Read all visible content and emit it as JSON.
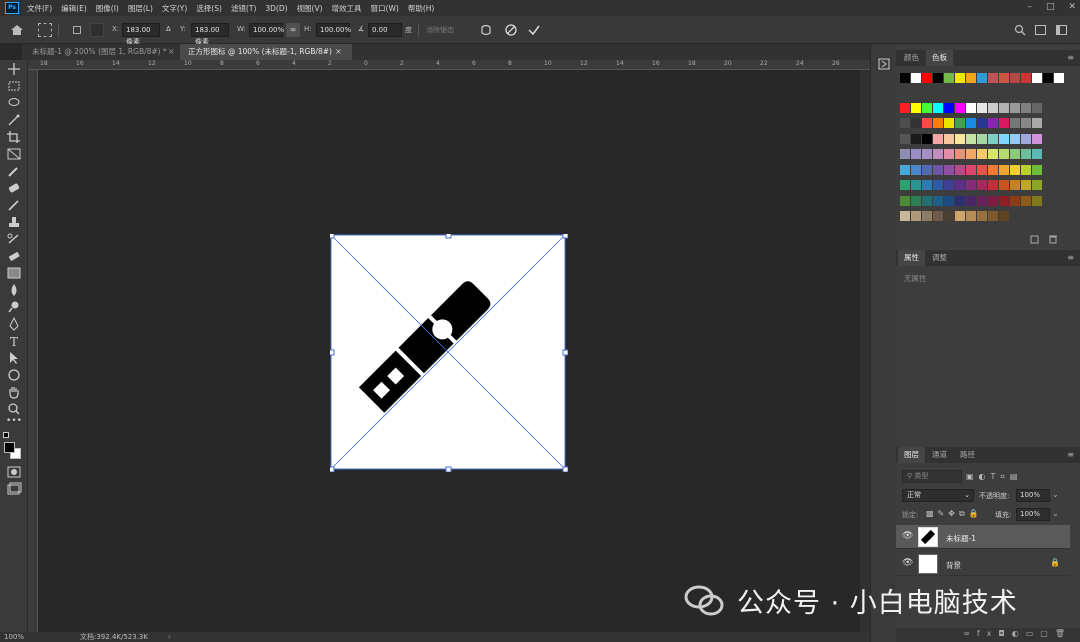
{
  "app": {
    "logo": "Ps"
  },
  "menu": [
    "文件(F)",
    "编辑(E)",
    "图像(I)",
    "图层(L)",
    "文字(Y)",
    "选择(S)",
    "滤镜(T)",
    "3D(D)",
    "视图(V)",
    "增效工具",
    "窗口(W)",
    "帮助(H)"
  ],
  "options": {
    "x_label": "X:",
    "x_value": "183.00 像素",
    "y_label": "Y:",
    "y_value": "183.00 像素",
    "w_label": "W:",
    "w_value": "100.00%",
    "h_label": "H:",
    "h_value": "100.00%",
    "angle_value": "0.00",
    "angle_unit": "度",
    "interp_label": "消除锯齿"
  },
  "tabs": [
    {
      "label": "未标题-1 @ 200% (图层 1, RGB/8#) *",
      "active": false
    },
    {
      "label": "正方形图标 @ 100% (未标题-1, RGB/8#)",
      "active": true
    }
  ],
  "ruler": {
    "h_ticks": [
      "18",
      "16",
      "14",
      "12",
      "10",
      "8",
      "6",
      "4",
      "2",
      "0",
      "2",
      "4",
      "6",
      "8",
      "10",
      "12",
      "14",
      "16",
      "18",
      "20",
      "22",
      "24",
      "26"
    ]
  },
  "status": {
    "zoom": "100%",
    "doc": "文档:392.4K/523.3K"
  },
  "swatches_panel": {
    "tab1": "颜色",
    "tab2": "色板"
  },
  "props_panel": {
    "tab1": "属性",
    "tab2": "调整",
    "empty": "无属性"
  },
  "layers_panel": {
    "tab1": "图层",
    "tab2": "通道",
    "tab3": "路径",
    "filter_placeholder": "类型",
    "blend_mode": "正常",
    "opacity_label": "不透明度:",
    "opacity_value": "100%",
    "lock_label": "锁定:",
    "fill_label": "填充:",
    "fill_value": "100%",
    "layers": [
      {
        "name": "未标题-1",
        "selected": true
      },
      {
        "name": "背景",
        "selected": false
      }
    ]
  },
  "watermark": {
    "text": "公众号 · 小白电脑技术"
  },
  "colors": {
    "swatch_rows": [
      [
        "#000000",
        "#ffffff",
        "#ff0000",
        "#000000",
        "#77b84a",
        "#f6e500",
        "#f7a31c",
        "#2f9ad6",
        "#b55",
        "#c54",
        "#b44",
        "#c33",
        "#fff",
        "#000",
        "#fff"
      ],
      [
        "#ff2020",
        "#ffff00",
        "#40ff40",
        "#00ffff",
        "#0000ff",
        "#ff00ff",
        "#ffffff",
        "#e6e6e6",
        "#cccccc",
        "#b3b3b3",
        "#999999",
        "#808080",
        "#666666"
      ],
      [
        "#4d4d4d",
        "#333333",
        "#ff4a4a",
        "#ff7f00",
        "#e6e600",
        "#43a047",
        "#1e88e5",
        "#283593",
        "#8e24aa",
        "#d81b60",
        "#777777",
        "#888888",
        "#aaaaaa"
      ],
      [
        "#555555",
        "#1a1a1a",
        "#000000",
        "#f4a6a6",
        "#f7c59f",
        "#f9e79f",
        "#c5e1a5",
        "#a5d6a7",
        "#80cbc4",
        "#81d4fa",
        "#90caf9",
        "#9fa8da",
        "#ce93d8"
      ],
      [
        "#8e8eb5",
        "#9b8ec4",
        "#a68fc2",
        "#c190c0",
        "#e38ea4",
        "#e6937a",
        "#f2a968",
        "#f6cc6a",
        "#d9e36f",
        "#b8d96b",
        "#8cc97c",
        "#6dbf9a",
        "#5cb8b2"
      ],
      [
        "#4aa8d8",
        "#4b88c9",
        "#5268b8",
        "#6b56a7",
        "#8f4e9f",
        "#b64a8b",
        "#d9486c",
        "#e5534b",
        "#ec7a3a",
        "#f2a531",
        "#f0cf2f",
        "#b9d12c",
        "#6fbb3c"
      ],
      [
        "#2e9f6f",
        "#2a9493",
        "#2a7db0",
        "#2d5ba5",
        "#3d3e94",
        "#5e2f8a",
        "#842b7a",
        "#a7285c",
        "#c0303a",
        "#c9531f",
        "#c98021",
        "#bfa624",
        "#8da62a"
      ],
      [
        "#4e8b35",
        "#2c7f55",
        "#236e6f",
        "#1d5f85",
        "#1f4a80",
        "#2a2f6e",
        "#4a2567",
        "#65225c",
        "#7d1d45",
        "#8f1f25",
        "#8f3b18",
        "#8e5a1a",
        "#7f7a1d"
      ],
      [
        "#c8b79a",
        "#b09a7c",
        "#8f7b63",
        "#6b5a47",
        "#4a3f33",
        "#d0a56b",
        "#b88b52",
        "#9c713d",
        "#7e5a2f",
        "#5f4322"
      ]
    ]
  }
}
